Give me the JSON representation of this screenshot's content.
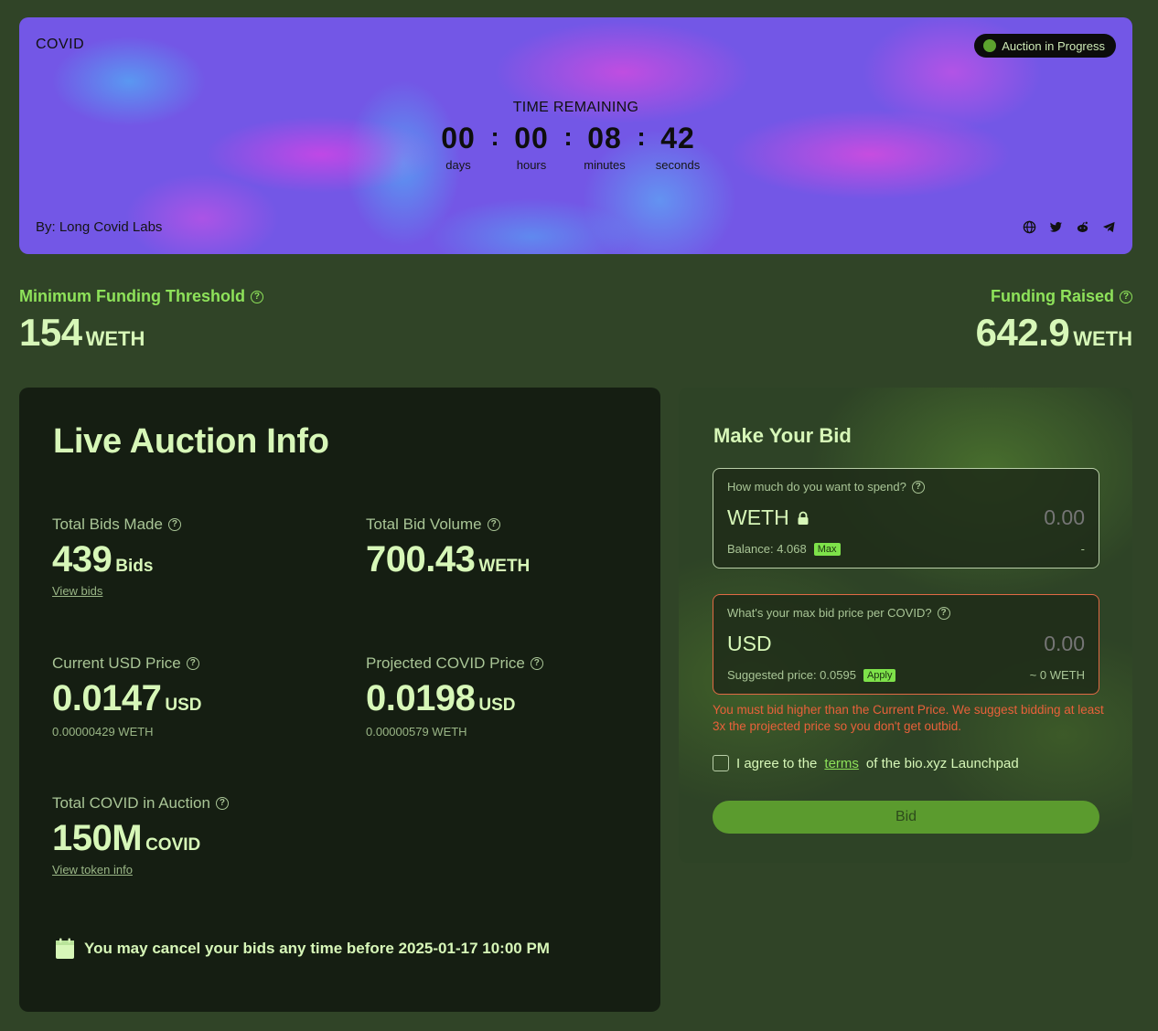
{
  "hero": {
    "token": "COVID",
    "status": "Auction in Progress",
    "timer_label": "TIME REMAINING",
    "timer": [
      {
        "value": "00",
        "unit": "days"
      },
      {
        "value": "00",
        "unit": "hours"
      },
      {
        "value": "08",
        "unit": "minutes"
      },
      {
        "value": "42",
        "unit": "seconds"
      }
    ],
    "separator": ":",
    "by": "By: Long Covid Labs",
    "socials": [
      "globe-icon",
      "twitter-icon",
      "reddit-icon",
      "telegram-icon"
    ]
  },
  "funding": {
    "min_label": "Minimum Funding Threshold",
    "min_value": "154",
    "min_unit": "WETH",
    "raised_label": "Funding Raised",
    "raised_value": "642.9",
    "raised_unit": "WETH",
    "help": "?"
  },
  "live": {
    "title": "Live Auction Info",
    "total_bids": {
      "label": "Total Bids Made",
      "value": "439",
      "unit": "Bids",
      "link": "View bids"
    },
    "total_volume": {
      "label": "Total Bid Volume",
      "value": "700.43",
      "unit": "WETH"
    },
    "current_price": {
      "label": "Current USD Price",
      "value": "0.0147",
      "unit": "USD",
      "sub": "0.00000429 WETH"
    },
    "projected_price": {
      "label": "Projected COVID Price",
      "value": "0.0198",
      "unit": "USD",
      "sub": "0.00000579 WETH"
    },
    "total_covid": {
      "label": "Total COVID in Auction",
      "value": "150M",
      "unit": "COVID",
      "link": "View token info"
    },
    "cancel_note": "You may cancel your bids any time before 2025-01-17 10:00 PM"
  },
  "bid": {
    "title": "Make Your Bid",
    "spend": {
      "question": "How much do you want to spend?",
      "currency": "WETH",
      "placeholder": "0.00",
      "balance": "Balance: 4.068",
      "max_label": "Max",
      "right": "-"
    },
    "price": {
      "question": "What's your max bid price per COVID?",
      "currency": "USD",
      "placeholder": "0.00",
      "suggested": "Suggested price: 0.0595",
      "apply_label": "Apply",
      "right": "~ 0 WETH"
    },
    "error": "You must bid higher than the Current Price. We suggest bidding at least 3x the projected price so you don't get outbid.",
    "agree_pre": "I agree to the",
    "agree_link": "terms",
    "agree_post": "of the bio.xyz Launchpad",
    "button": "Bid"
  },
  "colors": {
    "page_bg": "#304427",
    "hero_bg": "#7357e6",
    "accent_green": "#8ee25a",
    "error": "#e8613a",
    "card_bg": "#151e12"
  }
}
